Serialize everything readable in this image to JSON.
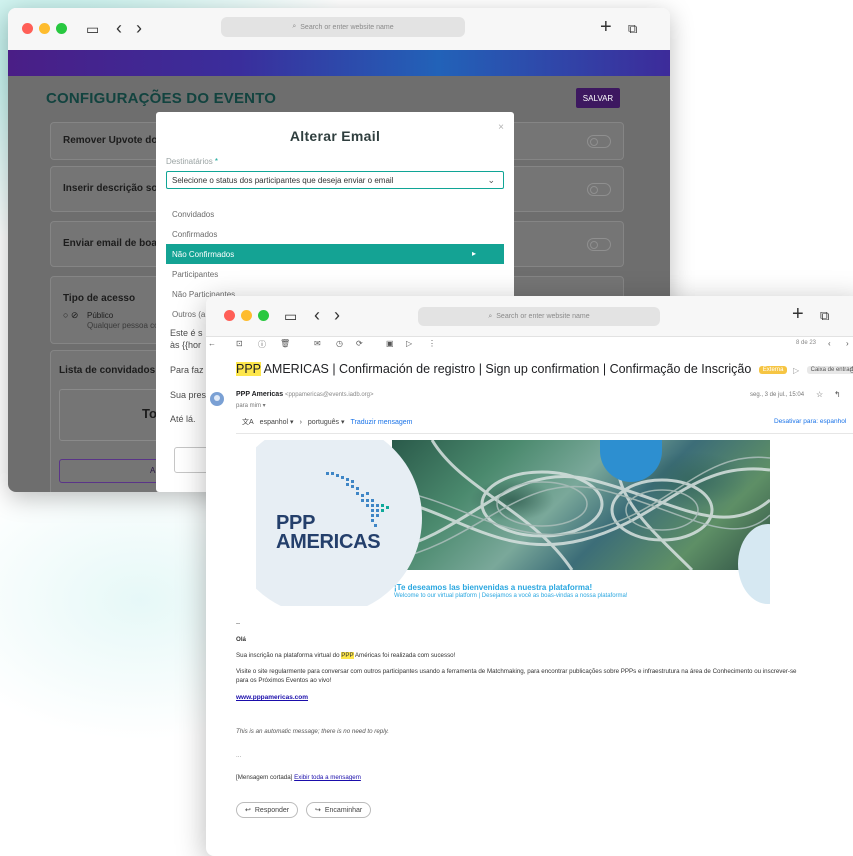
{
  "colors": {
    "accent": "#14a394",
    "brand_purple": "#3d1860",
    "gmail_link": "#1a73e8"
  },
  "browser": {
    "url_placeholder": "Search or enter website name"
  },
  "settings_page": {
    "title": "CONFIGURAÇÕES DO EVENTO",
    "save_label": "SALVAR",
    "cards": [
      {
        "label": "Remover Upvote do e"
      },
      {
        "label": "Inserir descrição sob"
      },
      {
        "label": "Enviar email de boas"
      }
    ],
    "access_type": {
      "label": "Tipo de acesso",
      "option": "Público",
      "option_desc": "Qualquer pessoa com"
    },
    "guest_list": {
      "label": "Lista de convidados co",
      "total": "Tot",
      "add_button": "AD"
    }
  },
  "modal": {
    "title": "Alterar Email",
    "close": "×",
    "field_label": "Destinatários",
    "required_mark": "*",
    "select_value": "Selecione o status dos participantes que deseja enviar o email",
    "options": [
      "Convidados",
      "Confirmados",
      "Não Confirmados",
      "Participantes",
      "Não Participantes",
      "Outros (a"
    ],
    "selected_option": "Não Confirmados",
    "body_lines": [
      "Este é s",
      "às {{hor",
      "Para faz",
      "Sua pres",
      "Até lá."
    ]
  },
  "email": {
    "toolbar_counter": "8 de 23",
    "subject_highlight": "PPP",
    "subject_rest": " AMERICAS | Confirmación de registro | Sign up confirmation | Confirmação de Inscrição",
    "tag_external": "Externa",
    "tag_inbox": "Caixa de entrada ×",
    "sender_name": "PPP Americas",
    "sender_email": "<pppamericas@events.iadb.org>",
    "to": "para mim ▾",
    "date": "seg., 3 de jul., 15:04",
    "translate": {
      "from": "espanhol",
      "to": "português",
      "link": "Traduzir mensagem",
      "disable": "Desativar para: espanhol"
    },
    "banner": {
      "logo_line1": "PPP",
      "logo_line2": "AMERICAS",
      "headline": "¡Te deseamos las bienvenidas a nuestra plataforma!",
      "subline": "Welcome to our virtual platform | Desejamos a você as boas-vindas a nossa plataforma!"
    },
    "dash": "--",
    "greeting": "Olá",
    "p1_before": "Sua inscrição na plataforma virtual do ",
    "p1_highlight": "PPP",
    "p1_after": " Américas foi realizada com sucesso!",
    "p2": "Visite o site regularmente para conversar com outros participantes usando a ferramenta de Matchmaking, para encontrar publicações sobre PPPs e infraestrutura na área de Conhecimento ou inscrever-se",
    "p2b": "para os Próximos Eventos ao vivo!",
    "website": "www.pppamericas.com",
    "auto_note": "This is an automatic message; there is no need to reply.",
    "ellipsis": "...",
    "cut_label": "[Mensagem cortada]",
    "cut_link": "Exibir toda a mensagem",
    "reply_label": "Responder",
    "forward_label": "Encaminhar"
  }
}
